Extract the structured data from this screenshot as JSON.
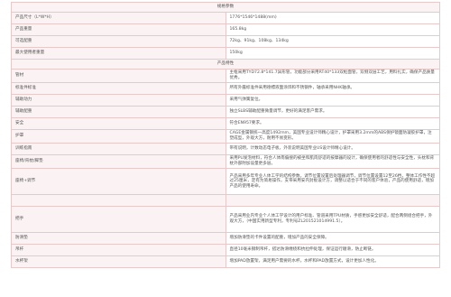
{
  "spec": {
    "title": "规格参数",
    "rows": [
      {
        "label": "产品尺寸（L*W*H）",
        "value": "1776*1546*1488(mm)"
      },
      {
        "label": "产品重量",
        "value": "165.8kg"
      },
      {
        "label": "可选配重",
        "value": "72kg、91kg、108kg、134kg"
      },
      {
        "label": "最大使用者重量",
        "value": "150kg"
      }
    ]
  },
  "features": {
    "title": "产品特性",
    "rows": [
      {
        "label": "管材",
        "value": "主框采用TYD72.8*141.7异形管，功能部分采用RT40*133双枢面管，双侧双层工艺，用料扎实，确保产品质量优秀。"
      },
      {
        "label": "标准件标准",
        "value": "所有外露标准件采用德標液面涂饰和不锈钢件，轴承采用NHK轴承。"
      },
      {
        "label": "辅助动力",
        "value": "采用气弹簧复位。"
      },
      {
        "label": "辅助配重",
        "value": "独立SLBS辅助配重微量调节，更好的满足客户需求。"
      },
      {
        "label": "安全",
        "value": "符合EN957要求。"
      },
      {
        "label": "护罩",
        "value": "CAGE金属钢统一高度1492mm，美国专业设计师精心设计，护罩采用3.2mm的ABS保护镜面防凝胶护罩，注塑成型，外观大方，耐用不易变形。"
      },
      {
        "label": "训练指南",
        "value": "带有说明，计数动态电子板，外装说明美国专业US设计师精心设计。"
      },
      {
        "label": "座椅/背枕/脚垫",
        "value": "采用PU发泡材料，符合人体南偏搜的被坐和肌肉舒适的按摩器的设计，确保使用者的舒适性与安全性，头枕和背枕外部附加设量更多层。"
      },
      {
        "label": "座椅+调节",
        "value": "产品采用多年专业人体工学的结构参数，调节位置设置后处理器调节，调节位置设置12至26档，整体工作性不超过25厘米，定有为简易操作，支带采用安内封板设计方，调整以适合于不同的客户体验，产品的使用舒适，增加产品的使用寿命。"
      },
      {
        "label": "",
        "value": ""
      },
      {
        "label": "把手",
        "value": "产品采用业内专业个人体工学设计的用户标准、管道采用TPU材质，手感更加安全舒适，配合两侧组合把手，外观大方，（中国实用新型专利，专利号ZL201521014991.5）。"
      },
      {
        "label": "防滑垫",
        "value": "增加防滑垫的卡件设置的配重，增加产品的安全保障。"
      },
      {
        "label": "吊杆",
        "value": "直径10毫米钢制吊杆，搭达防滑缠绕和抗拉伸处理，保证运行顺滑，防止断链。"
      },
      {
        "label": "水杯架",
        "value": "增加PAD放置架，满足用户需要的水杯，水杯和PAD放置方式，设计更加人性化。"
      }
    ]
  }
}
